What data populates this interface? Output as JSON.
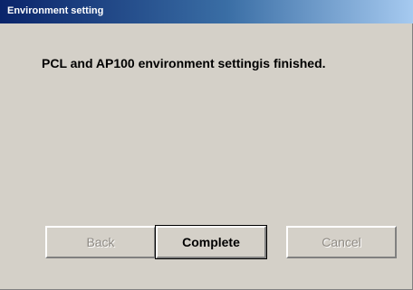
{
  "window": {
    "title": "Environment setting"
  },
  "message": "PCL and AP100 environment settingis finished.",
  "buttons": {
    "back": {
      "label": "Back",
      "enabled": false
    },
    "complete": {
      "label": "Complete",
      "enabled": true,
      "default": true
    },
    "cancel": {
      "label": "Cancel",
      "enabled": false
    }
  },
  "colors": {
    "title_bar_start": "#0a246a",
    "title_bar_end": "#a6caf0",
    "dialog_background": "#d4d0c8"
  }
}
